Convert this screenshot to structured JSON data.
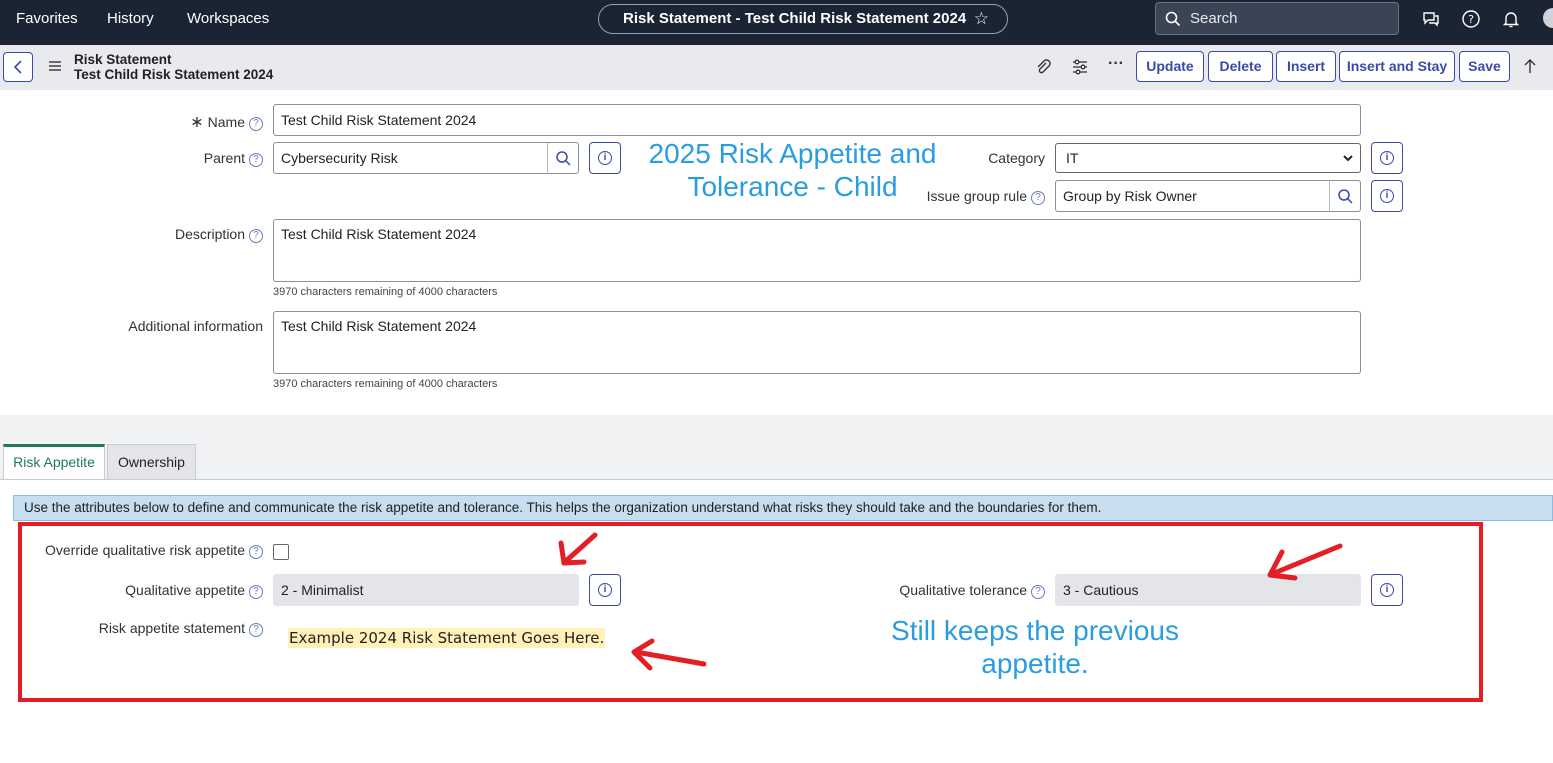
{
  "nav": {
    "favorites": "Favorites",
    "history": "History",
    "workspaces": "Workspaces"
  },
  "window_title": "Risk Statement - Test Child Risk Statement 2024",
  "search_label": "Search",
  "form_header": {
    "table_name": "Risk Statement",
    "record_name": "Test Child Risk Statement 2024",
    "buttons": {
      "update": "Update",
      "delete": "Delete",
      "insert": "Insert",
      "insert_and_stay": "Insert and Stay",
      "save": "Save"
    },
    "more": "···"
  },
  "fields": {
    "name": {
      "label": "Name",
      "value": "Test Child Risk Statement 2024",
      "required_mark": "∗"
    },
    "parent": {
      "label": "Parent",
      "value": "Cybersecurity Risk"
    },
    "category": {
      "label": "Category",
      "value": "IT"
    },
    "issue_group_rule": {
      "label": "Issue group rule",
      "value": "Group by Risk Owner"
    },
    "description": {
      "label": "Description",
      "value": "Test Child Risk Statement 2024",
      "counter": "3970 characters remaining of 4000 characters"
    },
    "additional_information": {
      "label": "Additional information",
      "value": "Test Child Risk Statement 2024",
      "counter": "3970 characters remaining of 4000 characters"
    }
  },
  "annotations": {
    "title_line1": "2025 Risk Appetite and",
    "title_line2": "Tolerance - Child",
    "note_line1": "Still keeps the previous",
    "note_line2": "appetite."
  },
  "tabs": [
    {
      "label": "Risk Appetite",
      "active": true
    },
    {
      "label": "Ownership",
      "active": false
    }
  ],
  "info_message": "Use the attributes below to define and communicate the risk appetite and tolerance. This helps the organization understand what risks they should take and the boundaries for them.",
  "risk_appetite": {
    "override_label": "Override qualitative risk appetite",
    "override_checked": false,
    "qualitative_appetite_label": "Qualitative appetite",
    "qualitative_appetite_value": "2 - Minimalist",
    "qualitative_tolerance_label": "Qualitative tolerance",
    "qualitative_tolerance_value": "3 - Cautious",
    "statement_label": "Risk appetite statement",
    "statement_value": "Example 2024 Risk Statement Goes Here."
  },
  "colors": {
    "topbar": "#1b2433",
    "accent": "#3b4aa8",
    "annotation": "#2a9de0",
    "highlight_box": "#e31e25",
    "active_tab": "#1f7a5a"
  }
}
